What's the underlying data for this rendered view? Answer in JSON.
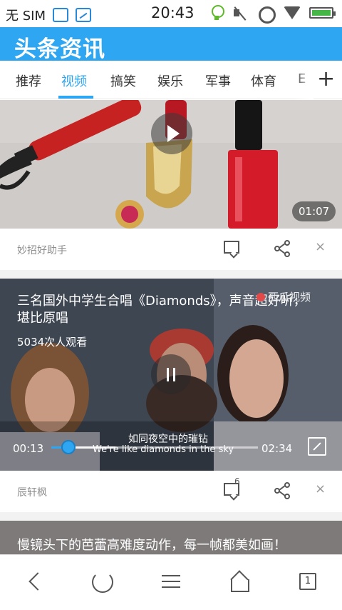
{
  "status_bar": {
    "carrier": "无 SIM",
    "time": "20:43"
  },
  "app": {
    "title": "头条资讯"
  },
  "tabs": [
    {
      "label": "推荐",
      "active": false
    },
    {
      "label": "视频",
      "active": true
    },
    {
      "label": "搞笑",
      "active": false
    },
    {
      "label": "娱乐",
      "active": false
    },
    {
      "label": "军事",
      "active": false
    },
    {
      "label": "体育",
      "active": false
    },
    {
      "label": "E",
      "active": false
    }
  ],
  "tabs_add_label": "+",
  "feed": [
    {
      "type": "video",
      "duration": "01:07",
      "source": "妙招好助手",
      "comment_count": "",
      "close_label": "×"
    },
    {
      "type": "video_playing",
      "title": "三名国外中学生合唱《Diamonds》，声音超好听，堪比原唱",
      "views": "5034次人观看",
      "brand": "西瓜视频",
      "current_time": "00:13",
      "total_time": "02:34",
      "progress": 0.084,
      "buffered": 0.31,
      "subtitle_cn": "如同夜空中的璀钻",
      "subtitle_en": "We're like diamonds in the sky",
      "source": "辰轩枫",
      "comment_count": "6",
      "close_label": "×"
    },
    {
      "type": "video",
      "title": "慢镜头下的芭蕾高难度动作，每一帧都美如画！"
    }
  ],
  "bottom_nav": {
    "tab_count": "1"
  }
}
